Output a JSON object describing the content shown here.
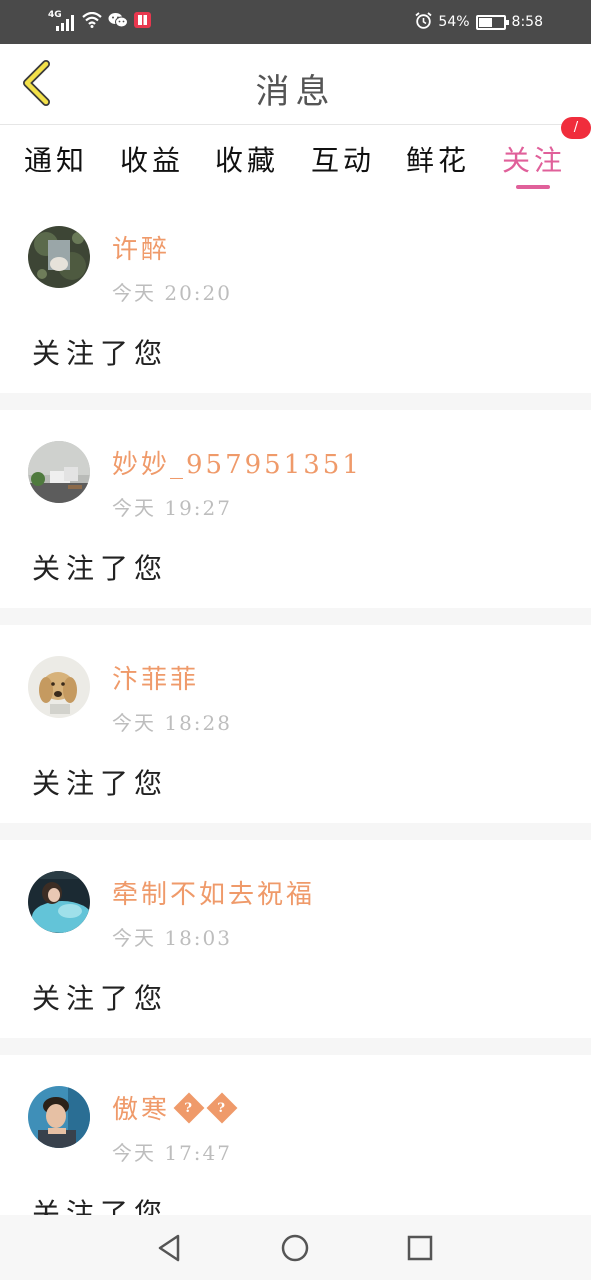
{
  "status_bar": {
    "network": "4G",
    "battery_percent": "54%",
    "battery_level": 0.54,
    "time": "8:58",
    "icons": [
      "signal-icon",
      "wifi-icon",
      "wechat-icon",
      "app-notification-icon",
      "alarm-icon",
      "battery-icon"
    ]
  },
  "header": {
    "title": "消息",
    "back_icon": "chevron-left-icon"
  },
  "tabs": {
    "items": [
      {
        "label": "通知"
      },
      {
        "label": "收益"
      },
      {
        "label": "收藏"
      },
      {
        "label": "互动"
      },
      {
        "label": "鲜花"
      },
      {
        "label": "关注"
      }
    ],
    "active": "关注",
    "badge": "/"
  },
  "notifications": [
    {
      "name": "许醉",
      "time": "今天  20:20",
      "message": "关注了您",
      "avatar": "avatar-photo-dark-landscape"
    },
    {
      "name": "妙妙_957951351",
      "time": "今天  19:27",
      "message": "关注了您",
      "avatar": "avatar-photo-room-interior"
    },
    {
      "name": "汴菲菲",
      "time": "今天  18:28",
      "message": "关注了您",
      "avatar": "avatar-photo-golden-dog"
    },
    {
      "name": "牵制不如去祝福",
      "time": "今天  18:03",
      "message": "关注了您",
      "avatar": "avatar-photo-girl-blue"
    },
    {
      "name": "傲寒",
      "name_suffix_icons": [
        "unknown-glyph-icon",
        "unknown-glyph-icon"
      ],
      "name_suffix": "??",
      "time": "今天  17:47",
      "message": "关注了您",
      "avatar": "avatar-photo-boy-blue"
    }
  ],
  "nav_bar": {
    "buttons": [
      "back-triangle-icon",
      "home-circle-icon",
      "recents-square-icon"
    ]
  },
  "colors": {
    "status_bar_bg": "#4a4a4a",
    "accent_pink": "#e0609a",
    "name_orange": "#ef9a6a",
    "badge_red": "#f02d3c",
    "back_arrow_yellow": "#f3e14a"
  }
}
